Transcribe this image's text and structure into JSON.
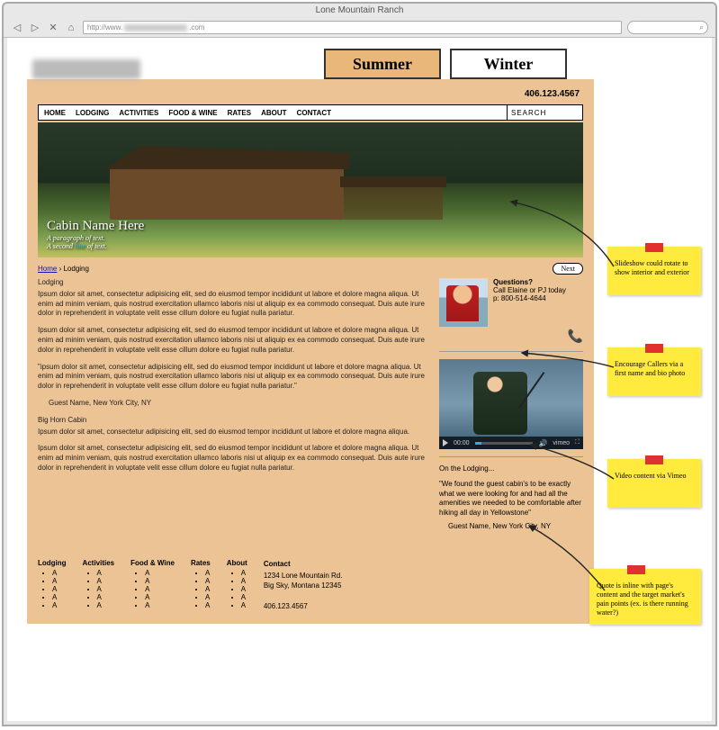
{
  "browser": {
    "title": "Lone Mountain Ranch",
    "url_prefix": "http://www.",
    "url_suffix": ".com",
    "search_icon": "⌕"
  },
  "season_tabs": {
    "summer": "Summer",
    "winter": "Winter"
  },
  "header_phone": "406.123.4567",
  "nav": [
    "HOME",
    "LODGING",
    "ACTIVITIES",
    "FOOD & WINE",
    "RATES",
    "ABOUT",
    "CONTACT"
  ],
  "search_placeholder": "SEARCH",
  "hero": {
    "title": "Cabin Name Here",
    "line1": "A paragraph of text.",
    "line2a": "A second ",
    "line2b": "line ",
    "line2c": "of text."
  },
  "breadcrumb": {
    "home": "Home",
    "sep": "›",
    "current": "Lodging"
  },
  "next_label": "Next",
  "main": {
    "h1": "Lodging",
    "p1": "Ipsum dolor sit amet, consectetur adipisicing elit, sed do eiusmod tempor incididunt ut labore et dolore magna aliqua. Ut enim ad minim veniam, quis nostrud exercitation ullamco laboris nisi ut aliquip ex ea commodo consequat. Duis aute irure dolor in reprehenderit in voluptate velit esse cillum dolore eu fugiat nulla pariatur.",
    "p2": "Ipsum dolor sit amet, consectetur adipisicing elit, sed do eiusmod tempor incididunt ut labore et dolore magna aliqua. Ut enim ad minim veniam, quis nostrud exercitation ullamco laboris nisi ut aliquip ex ea commodo consequat. Duis aute irure dolor in reprehenderit in voluptate velit esse cillum dolore eu fugiat nulla pariatur.",
    "p3": "\"ipsum dolor sit amet, consectetur adipisicing elit, sed do eiusmod tempor incididunt ut labore et dolore magna aliqua. Ut enim ad minim veniam, quis nostrud exercitation ullamco laboris nisi ut aliquip ex ea commodo consequat. Duis aute irure dolor in reprehenderit in voluptate velit esse cillum dolore eu fugiat nulla pariatur.\"",
    "attrib1": "Guest Name, New York City, NY",
    "h2": "Big Horn Cabin",
    "p4": "Ipsum dolor sit amet, consectetur adipisicing elit, sed do eiusmod tempor incididunt ut labore et dolore magna aliqua.",
    "p5": "Ipsum dolor sit amet, consectetur adipisicing elit, sed do eiusmod tempor incididunt ut labore et dolore magna aliqua. Ut enim ad minim veniam, quis nostrud exercitation ullamco laboris nisi ut aliquip ex ea commodo consequat. Duis aute irure dolor in reprehenderit in voluptate velit esse cillum dolore eu fugiat nulla pariatur."
  },
  "sidebar": {
    "q_title": "Questions?",
    "q_line": "Call Elaine or PJ today",
    "q_phone": "p: 800-514-4644",
    "phone_glyph": "📞",
    "video_time": "00:00",
    "video_brand": "vimeo",
    "quote_heading": "On the Lodging...",
    "quote_text": "\"We found the guest cabin's to be exactly what we were looking for and had all the amenities we needed to be comfortable after hiking all day in Yellowstone\"",
    "quote_attrib": "Guest Name, New York City, NY"
  },
  "footer": {
    "cols": [
      {
        "title": "Lodging",
        "items": [
          "A",
          "A",
          "A",
          "A",
          "A"
        ]
      },
      {
        "title": "Activities",
        "items": [
          "A",
          "A",
          "A",
          "A",
          "A"
        ]
      },
      {
        "title": "Food & Wine",
        "items": [
          "A",
          "A",
          "A",
          "A",
          "A"
        ]
      },
      {
        "title": "Rates",
        "items": [
          "A",
          "A",
          "A",
          "A",
          "A"
        ]
      },
      {
        "title": "About",
        "items": [
          "A",
          "A",
          "A",
          "A",
          "A"
        ]
      }
    ],
    "contact_title": "Contact",
    "addr1": "1234 Lone Mountain Rd.",
    "addr2": "Big Sky, Montana 12345",
    "phone": "406.123.4567"
  },
  "stickies": {
    "s1": "Slideshow could rotate to show interior and exterior",
    "s2": "Encourage Callers via a first name and bio photo",
    "s3": "Video content via Vimeo",
    "s4": "Quote is inline with page's content and the target market's pain points (ex. is there running water?)"
  }
}
